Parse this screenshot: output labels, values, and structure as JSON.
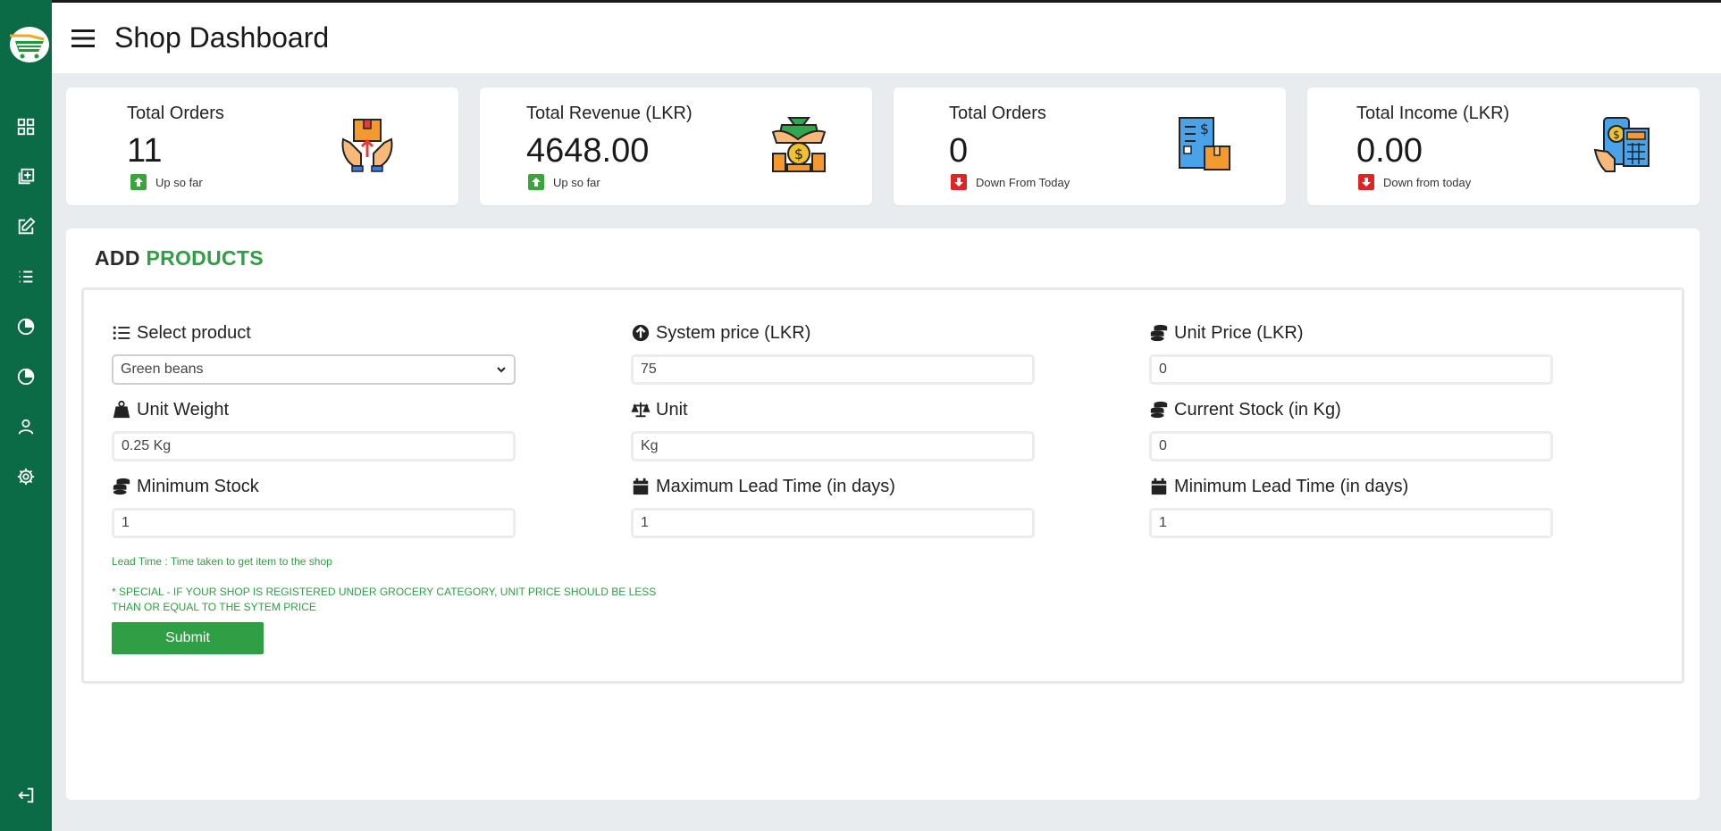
{
  "header": {
    "title": "Shop Dashboard"
  },
  "sidebar": {
    "items": [
      {
        "icon": "dashboard-grid-icon"
      },
      {
        "icon": "add-product-icon"
      },
      {
        "icon": "edit-icon"
      },
      {
        "icon": "list-icon"
      },
      {
        "icon": "pie-chart-icon"
      },
      {
        "icon": "pie-chart-icon"
      },
      {
        "icon": "user-icon"
      },
      {
        "icon": "gear-icon"
      }
    ],
    "logout_icon": "logout-icon"
  },
  "cards": [
    {
      "title": "Total Orders",
      "value": "11",
      "trend": "Up so far",
      "direction": "up",
      "icon": "order-box-hands-icon"
    },
    {
      "title": "Total Revenue (LKR)",
      "value": "4648.00",
      "trend": "Up so far",
      "direction": "up",
      "icon": "money-bag-coins-icon"
    },
    {
      "title": "Total Orders",
      "value": "0",
      "trend": "Down From Today",
      "direction": "down",
      "icon": "invoice-box-icon"
    },
    {
      "title": "Total Income (LKR)",
      "value": "0.00",
      "trend": "Down from today",
      "direction": "down",
      "icon": "phone-calculator-icon"
    }
  ],
  "form": {
    "title_prefix": "ADD",
    "title_accent": "PRODUCTS",
    "fields": {
      "select_product": {
        "label": "Select product",
        "value": "Green beans"
      },
      "system_price": {
        "label": "System price (LKR)",
        "value": "75"
      },
      "unit_price": {
        "label": "Unit Price (LKR)",
        "value": "0"
      },
      "unit_weight": {
        "label": "Unit Weight",
        "value": "0.25 Kg"
      },
      "unit": {
        "label": "Unit",
        "value": "Kg"
      },
      "current_stock": {
        "label": "Current Stock (in Kg)",
        "value": "0"
      },
      "minimum_stock": {
        "label": "Minimum Stock",
        "value": "1"
      },
      "max_lead_time": {
        "label": "Maximum Lead Time (in days)",
        "value": "1"
      },
      "min_lead_time": {
        "label": "Minimum Lead Time (in days)",
        "value": "1"
      }
    },
    "lead_time_note": "Lead Time : Time taken to get item to the shop",
    "special_note_line1": "* SPECIAL - IF YOUR SHOP IS REGISTERED UNDER GROCERY CATEGORY, UNIT PRICE SHOULD BE LESS",
    "special_note_line2": "THAN OR EQUAL TO THE SYTEM PRICE",
    "submit_label": "Submit"
  },
  "colors": {
    "sidebar": "#0a6b46",
    "accent": "#2f9e44",
    "up": "#3aa53a",
    "down": "#e02424"
  }
}
